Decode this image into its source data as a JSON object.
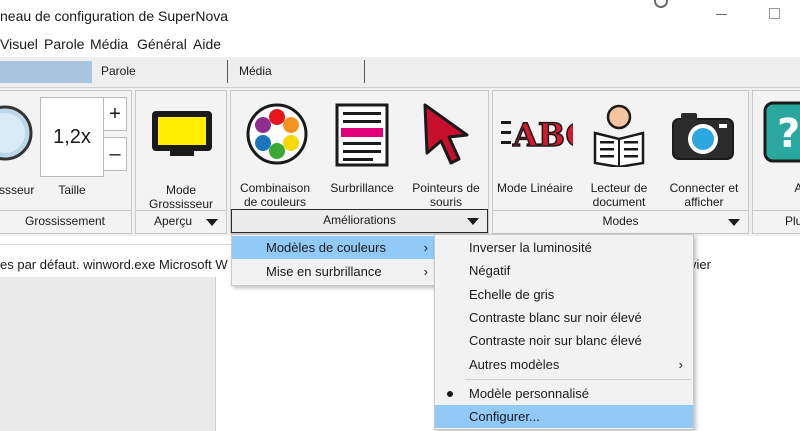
{
  "window": {
    "title": "neau de configuration de SuperNova"
  },
  "menubar": [
    {
      "label": "Visuel"
    },
    {
      "label": "Parole"
    },
    {
      "label": "Média"
    },
    {
      "label": "Général"
    },
    {
      "label": "Aide"
    }
  ],
  "tabs": [
    {
      "label": "Parole"
    },
    {
      "label": "Média"
    }
  ],
  "ribbon": {
    "grossissement": {
      "footer": "Grossissement",
      "magnifier_label": "ssseur",
      "zoom_value": "1,2x",
      "zoom_label": "Taille",
      "plus": "+",
      "minus": "–"
    },
    "apercu": {
      "footer": "Aperçu",
      "mode_label": "Mode\nGrossisseur"
    },
    "ameliorations": {
      "footer": "Améliorations",
      "buttons": [
        {
          "label": "Combinaison\nde couleurs"
        },
        {
          "label": "Surbrillance"
        },
        {
          "label": "Pointeurs de\nsouris"
        }
      ]
    },
    "modes": {
      "footer": "Modes",
      "abc_text": "ABC",
      "buttons": [
        {
          "label": "Mode Linéaire"
        },
        {
          "label": "Lecteur de\ndocument"
        },
        {
          "label": "Connecter et\nafficher"
        }
      ]
    },
    "aide": {
      "footer": "Plu",
      "label": "Aid"
    }
  },
  "status": {
    "path_text": "es par défaut. winword.exe Microsoft W",
    "right_text": "vier"
  },
  "menu_main": [
    {
      "label": "Modèles de couleurs",
      "arrow": "›"
    },
    {
      "label": "Mise en surbrillance",
      "arrow": "›"
    }
  ],
  "menu_sub": [
    {
      "label": "Inverser la luminosité"
    },
    {
      "label": "Négatif"
    },
    {
      "label": "Echelle de gris"
    },
    {
      "label": "Contraste blanc sur noir élevé"
    },
    {
      "label": "Contraste noir sur blanc élevé"
    },
    {
      "label": "Autres modèles",
      "arrow": "›"
    },
    {
      "label": "Modèle personnalisé"
    },
    {
      "label": "Configurer..."
    }
  ],
  "colors": {
    "accent": "#91c9f7",
    "tab_active": "#a9c4de",
    "highlight_bar": "#e0007a",
    "screen_yellow": "#ffee00"
  }
}
